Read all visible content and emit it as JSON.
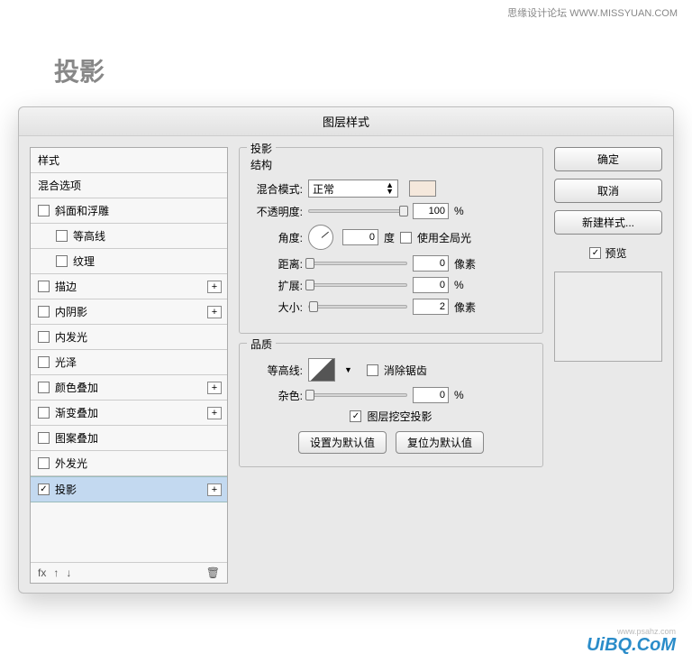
{
  "watermark_top": "思缘设计论坛  WWW.MISSYUAN.COM",
  "page_title": "投影",
  "dialog_title": "图层样式",
  "effects": {
    "header1": "样式",
    "header2": "混合选项",
    "items": [
      {
        "label": "斜面和浮雕",
        "checked": false,
        "plus": false
      },
      {
        "label": "等高线",
        "checked": false,
        "indent": true
      },
      {
        "label": "纹理",
        "checked": false,
        "indent": true
      },
      {
        "label": "描边",
        "checked": false,
        "plus": true
      },
      {
        "label": "内阴影",
        "checked": false,
        "plus": true
      },
      {
        "label": "内发光",
        "checked": false
      },
      {
        "label": "光泽",
        "checked": false
      },
      {
        "label": "颜色叠加",
        "checked": false,
        "plus": true
      },
      {
        "label": "渐变叠加",
        "checked": false,
        "plus": true
      },
      {
        "label": "图案叠加",
        "checked": false
      },
      {
        "label": "外发光",
        "checked": false
      },
      {
        "label": "投影",
        "checked": true,
        "plus": true,
        "selected": true
      }
    ],
    "footer_fx": "fx"
  },
  "section_title": "投影",
  "structure_title": "结构",
  "blend_mode_label": "混合模式:",
  "blend_mode_value": "正常",
  "opacity_label": "不透明度:",
  "opacity_value": "100",
  "opacity_unit": "%",
  "angle_label": "角度:",
  "angle_value": "0",
  "angle_unit": "度",
  "global_light_label": "使用全局光",
  "distance_label": "距离:",
  "distance_value": "0",
  "distance_unit": "像素",
  "spread_label": "扩展:",
  "spread_value": "0",
  "spread_unit": "%",
  "size_label": "大小:",
  "size_value": "2",
  "size_unit": "像素",
  "quality_title": "品质",
  "contour_label": "等高线:",
  "antialias_label": "消除锯齿",
  "noise_label": "杂色:",
  "noise_value": "0",
  "noise_unit": "%",
  "knockout_label": "图层挖空投影",
  "make_default": "设置为默认值",
  "reset_default": "复位为默认值",
  "ok": "确定",
  "cancel": "取消",
  "new_style": "新建样式...",
  "preview": "预览",
  "bottom_wm": "UiBQ.CoM",
  "bottom_wm2": "www.psahz.com"
}
